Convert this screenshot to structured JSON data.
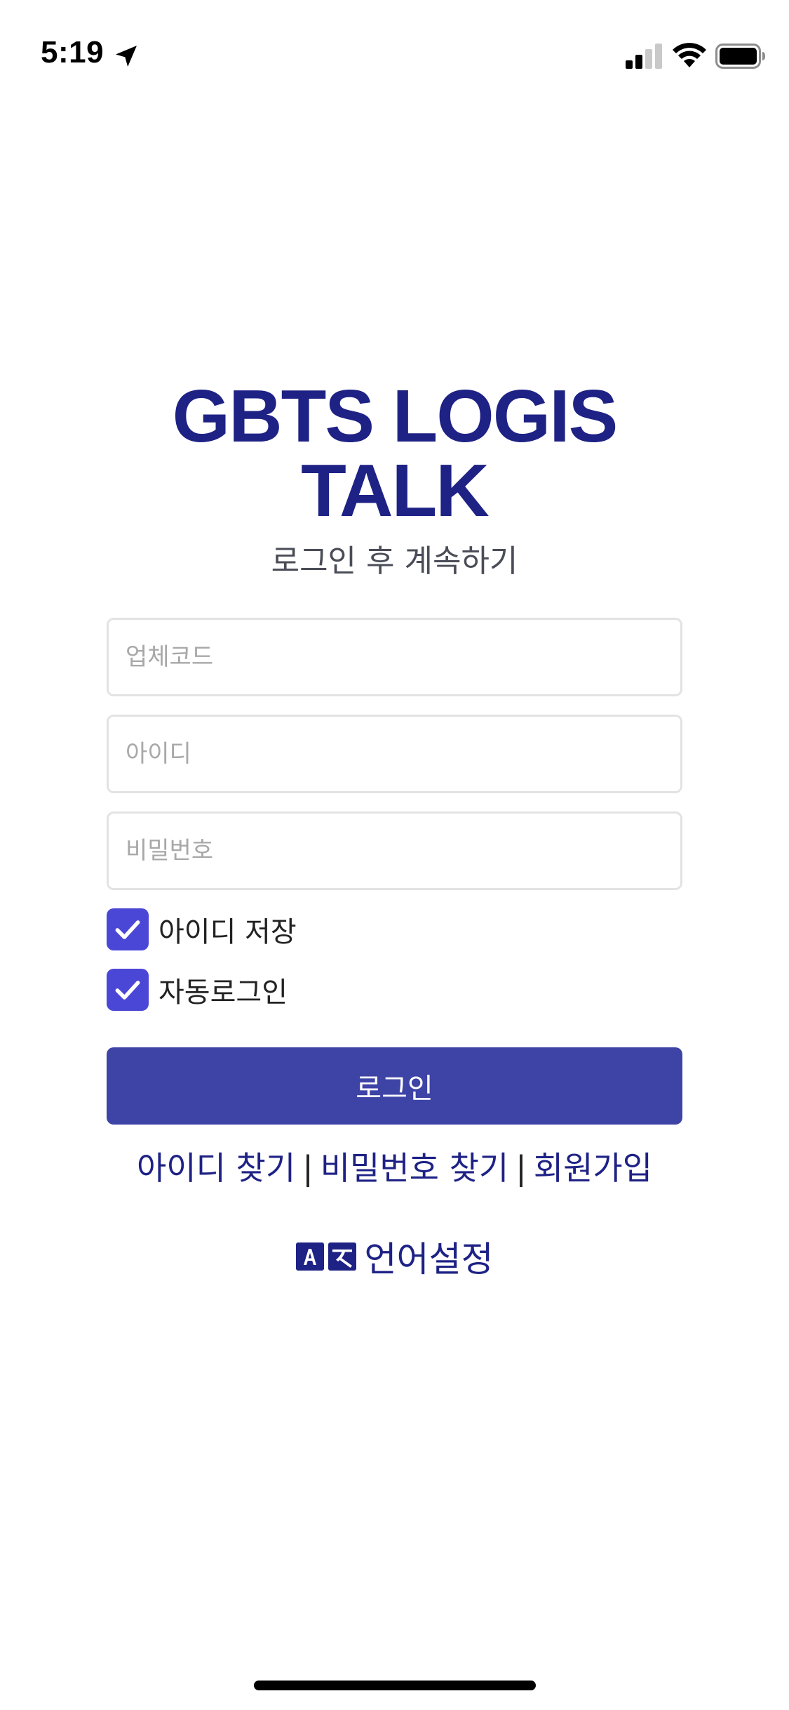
{
  "status_bar": {
    "time": "5:19",
    "icons": [
      "location-arrow-icon",
      "cellular-signal-icon",
      "wifi-icon",
      "battery-icon"
    ]
  },
  "header": {
    "title_line1": "GBTS LOGIS",
    "title_line2": "TALK",
    "subtitle": "로그인 후 계속하기"
  },
  "form": {
    "company_code": {
      "placeholder": "업체코드",
      "value": ""
    },
    "user_id": {
      "placeholder": "아이디",
      "value": ""
    },
    "password": {
      "placeholder": "비밀번호",
      "value": ""
    },
    "save_id": {
      "label": "아이디 저장",
      "checked": true
    },
    "auto_login": {
      "label": "자동로그인",
      "checked": true
    },
    "login_button": "로그인"
  },
  "links": {
    "find_id": "아이디 찾기",
    "find_password": "비밀번호 찾기",
    "sign_up": "회원가입",
    "separator": "|"
  },
  "language": {
    "icon": "translate-icon",
    "label": "언어설정"
  },
  "colors": {
    "brand": "#1e2285",
    "checkbox": "#4b47d6",
    "button": "#3e43a6",
    "subtitle": "#4a4d57"
  }
}
